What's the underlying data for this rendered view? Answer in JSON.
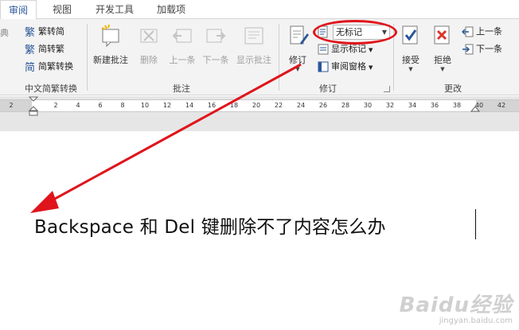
{
  "tabs": [
    "审阅",
    "视图",
    "开发工具",
    "加载项"
  ],
  "ribbon": {
    "chinese": {
      "partial_left": "典",
      "trad_to_simp": "繁转简",
      "simp_to_trad": "简转繁",
      "convert": "简繁转换",
      "group_label": "中文简繁转换"
    },
    "comments": {
      "new": "新建批注",
      "delete": "删除",
      "prev": "上一条",
      "next": "下一条",
      "show": "显示批注",
      "group_label": "批注"
    },
    "tracking": {
      "track": "修订",
      "markup_select": "无标记",
      "show_markup": "显示标记",
      "review_pane": "审阅窗格",
      "group_label": "修订"
    },
    "changes": {
      "accept": "接受",
      "reject": "拒绝",
      "prev": "上一条",
      "next": "下一条",
      "group_label": "更改"
    }
  },
  "ruler": {
    "ticks": [
      "2",
      "2",
      "4",
      "6",
      "8",
      "10",
      "12",
      "14",
      "16",
      "18",
      "20",
      "22",
      "24",
      "26",
      "28",
      "30",
      "32",
      "34",
      "36",
      "38",
      "40",
      "42"
    ]
  },
  "document": {
    "text": "Backspace 和 Del 键删除不了内容怎么办"
  },
  "watermark": {
    "logo": "Baidu经验",
    "url": "jingyan.baidu.com"
  },
  "colors": {
    "accent": "#2b579a",
    "annotation_red": "#e0141b"
  }
}
